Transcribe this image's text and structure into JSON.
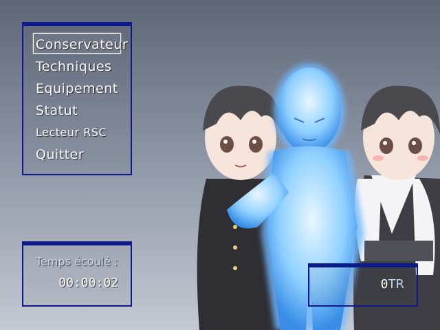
{
  "menu": {
    "items": [
      {
        "label": "Conservateur",
        "selected": true
      },
      {
        "label": "Techniques"
      },
      {
        "label": "Equipement"
      },
      {
        "label": "Statut"
      },
      {
        "label": "Lecteur RSC"
      },
      {
        "label": "Quitter"
      }
    ]
  },
  "playtime": {
    "label": "Temps écoulé :",
    "value": "00:00:02"
  },
  "gold": {
    "amount": "0",
    "unit": "TR"
  },
  "colors": {
    "window_border": "#0c1a8c",
    "label_text": "#c6d6f4",
    "spirit_glow": "#7fc8ff"
  },
  "party": {
    "characters": [
      "boy-in-gakuran",
      "ice-spirit",
      "girl-in-hakama"
    ]
  }
}
